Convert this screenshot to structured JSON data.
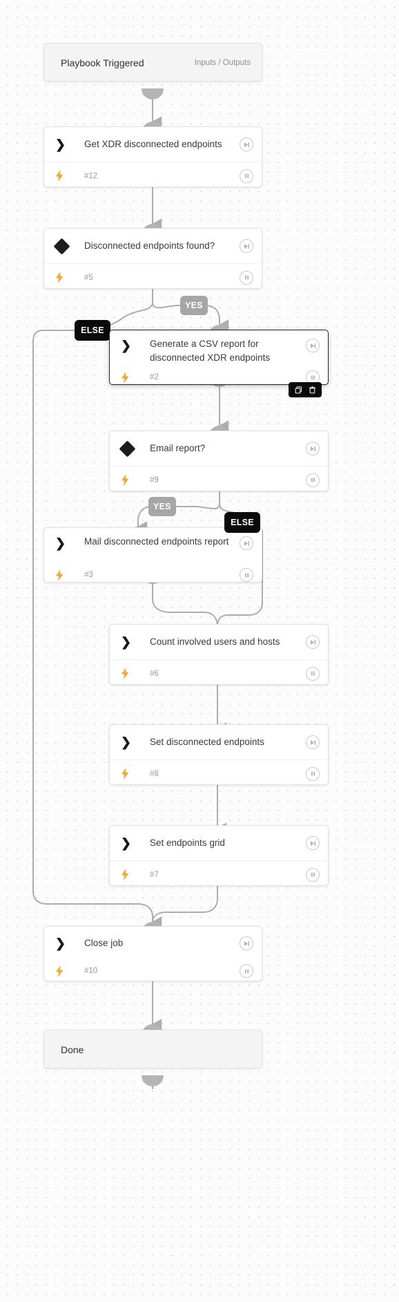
{
  "canvas": {
    "background_color": "#fcfcfc",
    "grid_dot_color": "#d8d8d8"
  },
  "colors": {
    "accent_bolt": "#f5a623",
    "badge_yes": "#a6a6a6",
    "badge_else": "#0a0a0a",
    "edge": "#adadad",
    "node_border": "#e2e2e2",
    "text": "#3a3a3a",
    "muted_text": "#9a9a9a"
  },
  "start_node": {
    "title": "Playbook Triggered",
    "io_label": "Inputs / Outputs"
  },
  "end_node": {
    "title": "Done"
  },
  "nodes": [
    {
      "title": "Get XDR disconnected endpoints",
      "id_label": "#12",
      "kind": "task",
      "icon": "chevron-right-icon",
      "has_bolt": true,
      "skip_icon": "skip-next-icon",
      "pause_icon": "pause-icon"
    },
    {
      "title": "Disconnected endpoints found?",
      "id_label": "#5",
      "kind": "condition",
      "icon": "diamond-icon",
      "has_bolt": true,
      "skip_icon": "skip-next-icon",
      "pause_icon": "pause-icon"
    },
    {
      "title": "Generate a CSV report for disconnected XDR endpoints",
      "id_label": "#2",
      "kind": "task",
      "icon": "chevron-right-icon",
      "has_bolt": true,
      "skip_icon": "skip-next-icon",
      "pause_icon": "pause-icon",
      "selected": true
    },
    {
      "title": "Email report?",
      "id_label": "#9",
      "kind": "condition",
      "icon": "diamond-icon",
      "has_bolt": true,
      "skip_icon": "skip-next-icon",
      "pause_icon": "pause-icon"
    },
    {
      "title": "Mail disconnected endpoints report",
      "id_label": "#3",
      "kind": "task",
      "icon": "chevron-right-icon",
      "has_bolt": true,
      "skip_icon": "skip-next-icon",
      "pause_icon": "pause-icon"
    },
    {
      "title": "Count involved users and hosts",
      "id_label": "#6",
      "kind": "task",
      "icon": "chevron-right-icon",
      "has_bolt": true,
      "skip_icon": "skip-next-icon",
      "pause_icon": "pause-icon"
    },
    {
      "title": "Set disconnected endpoints",
      "id_label": "#8",
      "kind": "task",
      "icon": "chevron-right-icon",
      "has_bolt": true,
      "skip_icon": "skip-next-icon",
      "pause_icon": "pause-icon"
    },
    {
      "title": "Set endpoints grid",
      "id_label": "#7",
      "kind": "task",
      "icon": "chevron-right-icon",
      "has_bolt": true,
      "skip_icon": "skip-next-icon",
      "pause_icon": "pause-icon"
    },
    {
      "title": "Close job",
      "id_label": "#10",
      "kind": "task",
      "icon": "chevron-right-icon",
      "has_bolt": true,
      "skip_icon": "skip-next-icon",
      "pause_icon": "pause-icon"
    }
  ],
  "branch_labels": {
    "yes_1": "YES",
    "else_1": "ELSE",
    "yes_2": "YES",
    "else_2": "ELSE"
  },
  "selection_toolbar": {
    "copy_icon": "copy-icon",
    "delete_icon": "trash-icon"
  }
}
